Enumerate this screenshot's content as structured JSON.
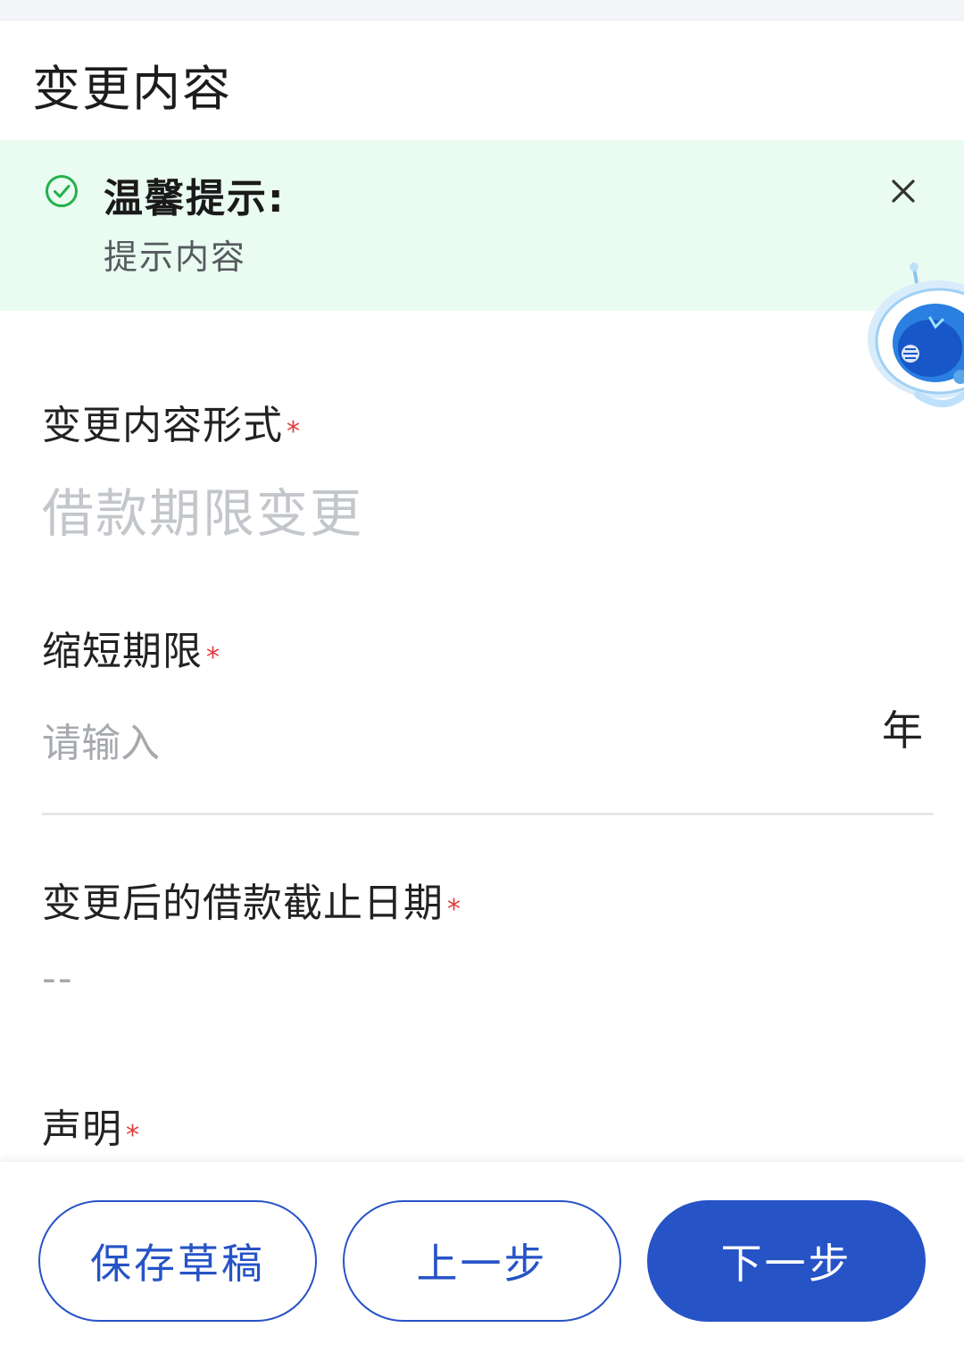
{
  "header": {
    "title": "变更内容"
  },
  "notice": {
    "title": "温馨提示:",
    "body": "提示内容",
    "check_icon": "check-circle-icon",
    "close_icon": "close-icon",
    "accent_color": "#22b14c",
    "background_color": "#eafbf1"
  },
  "assistant": {
    "icon": "robot-assistant-icon"
  },
  "form": {
    "change_type": {
      "label": "变更内容形式",
      "required_mark": "*",
      "value": "借款期限变更"
    },
    "shorten_period": {
      "label": "缩短期限",
      "required_mark": "*",
      "placeholder": "请输入",
      "value": "",
      "unit": "年"
    },
    "new_due_date": {
      "label": "变更后的借款截止日期",
      "required_mark": "*",
      "value": "--"
    },
    "declaration": {
      "label": "声明",
      "required_mark": "*"
    }
  },
  "actions": {
    "save_draft": "保存草稿",
    "previous": "上一步",
    "next": "下一步",
    "primary_color": "#2653c6"
  }
}
